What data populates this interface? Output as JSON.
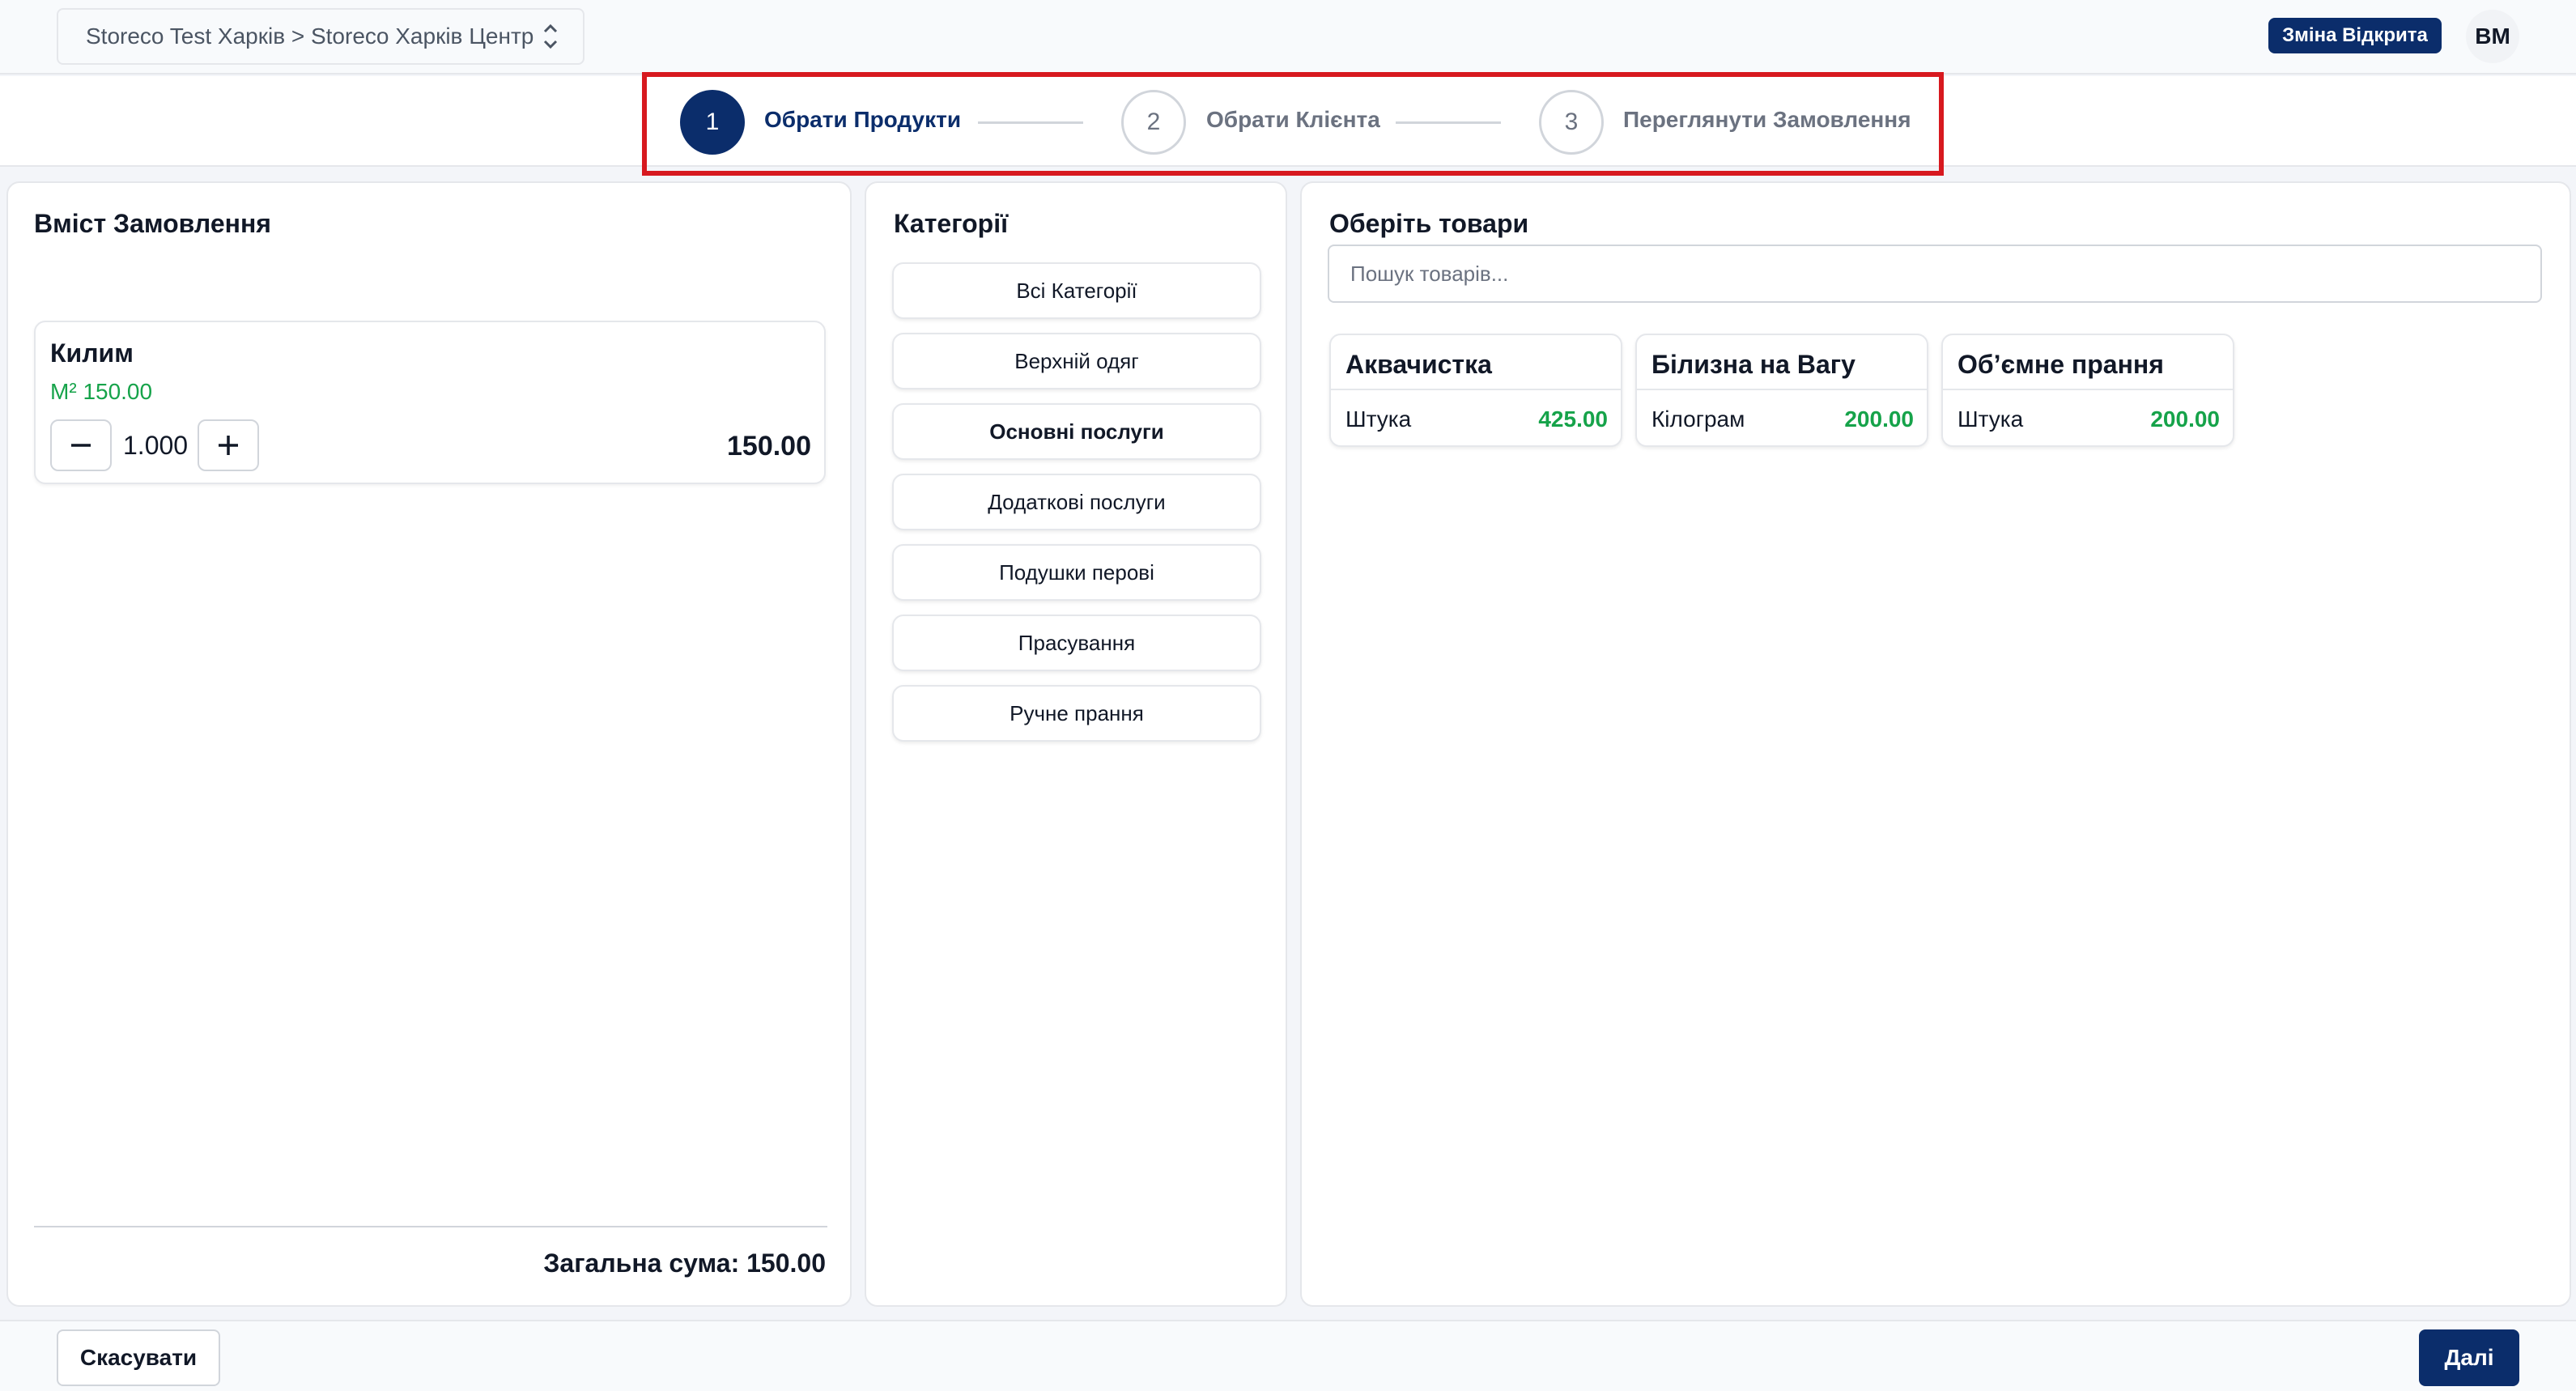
{
  "header": {
    "store_path": "Storeco Test Харків > Storeco Харків Центр",
    "shift_status": "Зміна Відкрита",
    "user_initials": "ВМ"
  },
  "stepper": {
    "steps": [
      {
        "number": "1",
        "label": "Обрати Продукти",
        "state": "active"
      },
      {
        "number": "2",
        "label": "Обрати Клієнта",
        "state": "inactive"
      },
      {
        "number": "3",
        "label": "Переглянути Замовлення",
        "state": "inactive"
      }
    ]
  },
  "order": {
    "title": "Вміст Замовлення",
    "items": [
      {
        "name": "Килим",
        "unit": "М²",
        "unit_price": "150.00",
        "quantity": "1.000",
        "total": "150.00"
      }
    ],
    "total_label": "Загальна сума: 150.00"
  },
  "categories": {
    "title": "Категорії",
    "items": [
      {
        "label": "Всі Категорії"
      },
      {
        "label": "Верхній одяг"
      },
      {
        "label": "Основні послуги",
        "selected": true
      },
      {
        "label": "Додаткові послуги"
      },
      {
        "label": "Подушки перові"
      },
      {
        "label": "Прасування"
      },
      {
        "label": "Ручне прання"
      }
    ]
  },
  "products": {
    "title": "Оберіть товари",
    "search_placeholder": "Пошук товарів...",
    "items": [
      {
        "name": "Аквачистка",
        "unit": "Штука",
        "price": "425.00"
      },
      {
        "name": "Білизна на Вагу",
        "unit": "Кілограм",
        "price": "200.00"
      },
      {
        "name": "Об’ємне прання",
        "unit": "Штука",
        "price": "200.00"
      }
    ]
  },
  "footer": {
    "cancel_label": "Скасувати",
    "next_label": "Далі"
  },
  "colors": {
    "primary": "#0b2d6b",
    "price_green": "#16a34a",
    "highlight_red": "#d7191f"
  }
}
